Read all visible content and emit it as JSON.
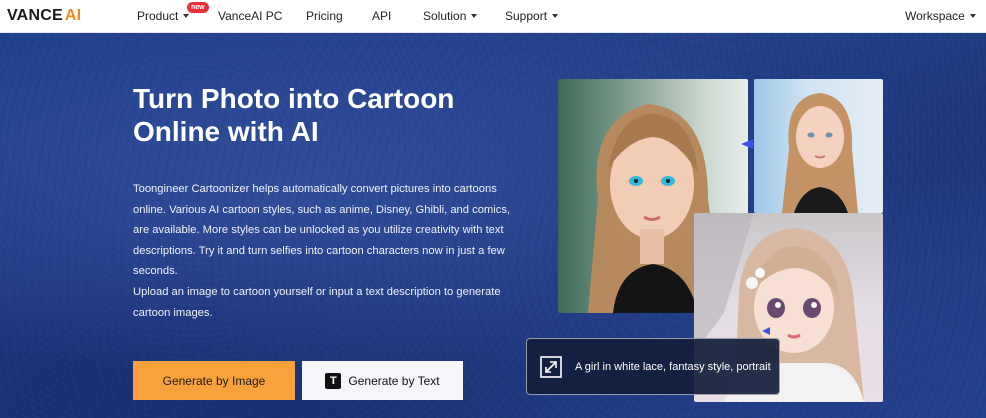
{
  "nav": {
    "logo_main": "VANCE",
    "logo_ai": "AI",
    "product": "Product",
    "new_badge": "new",
    "vanceai_pc": "VanceAI PC",
    "pricing": "Pricing",
    "api": "API",
    "solution": "Solution",
    "support": "Support",
    "workspace": "Workspace"
  },
  "hero": {
    "title": "Turn Photo into Cartoon Online with AI",
    "description": "Toongineer Cartoonizer helps automatically convert pictures into cartoons online. Various AI cartoon styles, such as anime, Disney, Ghibli, and comics, are available. More styles can be unlocked as you utilize creativity with text descriptions. Try it and turn selfies into cartoon characters now in just a few seconds.",
    "description2": "Upload an image to cartoon yourself or input a text description to generate cartoon images.",
    "btn_image": "Generate by Image",
    "btn_text": "Generate by Text",
    "btn_text_icon": "T",
    "prompt_text": "A girl in white lace, fantasy style, portrait"
  },
  "colors": {
    "accent_orange": "#f9a13a",
    "logo_ai": "#f08a1c",
    "badge_red": "#e8303a",
    "arrow_blue": "#3c52e8"
  }
}
